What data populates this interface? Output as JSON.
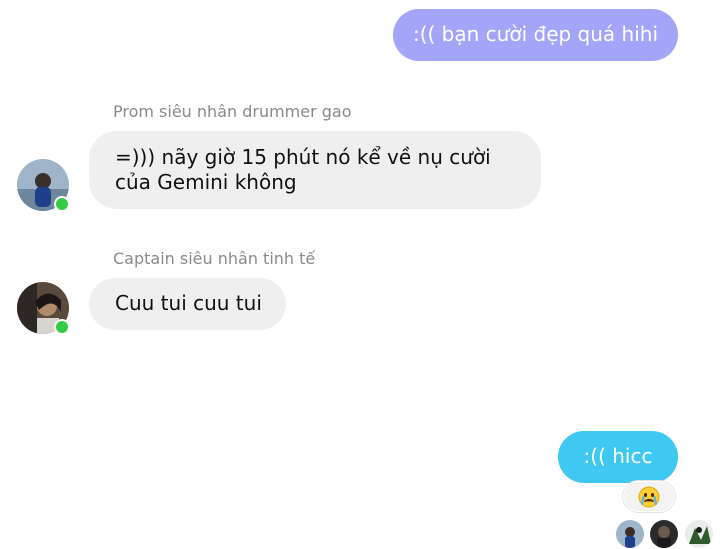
{
  "messages": [
    {
      "direction": "outgoing",
      "text": ":(( bạn cười đẹp quá hihi"
    },
    {
      "direction": "incoming",
      "sender": "Prom siêu nhân drummer gao",
      "text": "=))) nãy giờ 15 phút nó kể về nụ cười của Gemini không"
    },
    {
      "direction": "incoming",
      "sender": "Captain siêu nhân tinh tế",
      "text": "Cuu tui cuu tui"
    },
    {
      "direction": "outgoing",
      "text": ":(( hicc"
    }
  ],
  "reaction": {
    "emoji": "crying-face-icon"
  },
  "read_receipts": [
    "seen-avatar-1",
    "seen-avatar-2",
    "seen-avatar-3"
  ],
  "colors": {
    "outgoing_bubble_purple": "#a4a4f8",
    "outgoing_bubble_blue": "#3fc8f1",
    "incoming_bubble": "#efefef",
    "sender_name": "#8a8a8a",
    "online_indicator": "#33cc44"
  }
}
